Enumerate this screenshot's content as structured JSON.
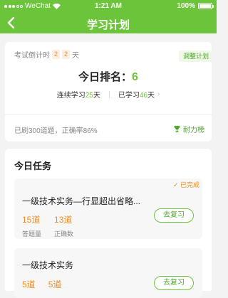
{
  "status_bar": {
    "carrier": "WeChat",
    "time": "1:21 AM",
    "battery": "100%"
  },
  "nav": {
    "title": "学习计划"
  },
  "top": {
    "countdown_label": "考试倒计时",
    "countdown_digits": [
      "2",
      "2"
    ],
    "countdown_unit": "天",
    "adjust_label": "调整计划",
    "rank_label": "今日排名：",
    "rank_value": "6",
    "streak_prefix": "连续学习",
    "streak_value": "25",
    "streak_unit": "天",
    "studied_prefix": "已学习",
    "studied_value": "46",
    "studied_unit": "天",
    "progress_text": "已刷300道题，正确率86%",
    "endurance_label": "耐力榜"
  },
  "tasks": {
    "title": "今日任务",
    "items": [
      {
        "title": "一级技术实务—行显超出省略...",
        "done_label": "已完成",
        "answered_value": "15道",
        "answered_label": "答题量",
        "correct_value": "13道",
        "correct_label": "正确数",
        "button": "去复习"
      },
      {
        "title": "一级技术实务",
        "answered_value": "5道",
        "correct_value": "5道",
        "button": "去复习"
      }
    ]
  },
  "colors": {
    "brand": "#6cc43b",
    "accent": "#f08c22"
  }
}
